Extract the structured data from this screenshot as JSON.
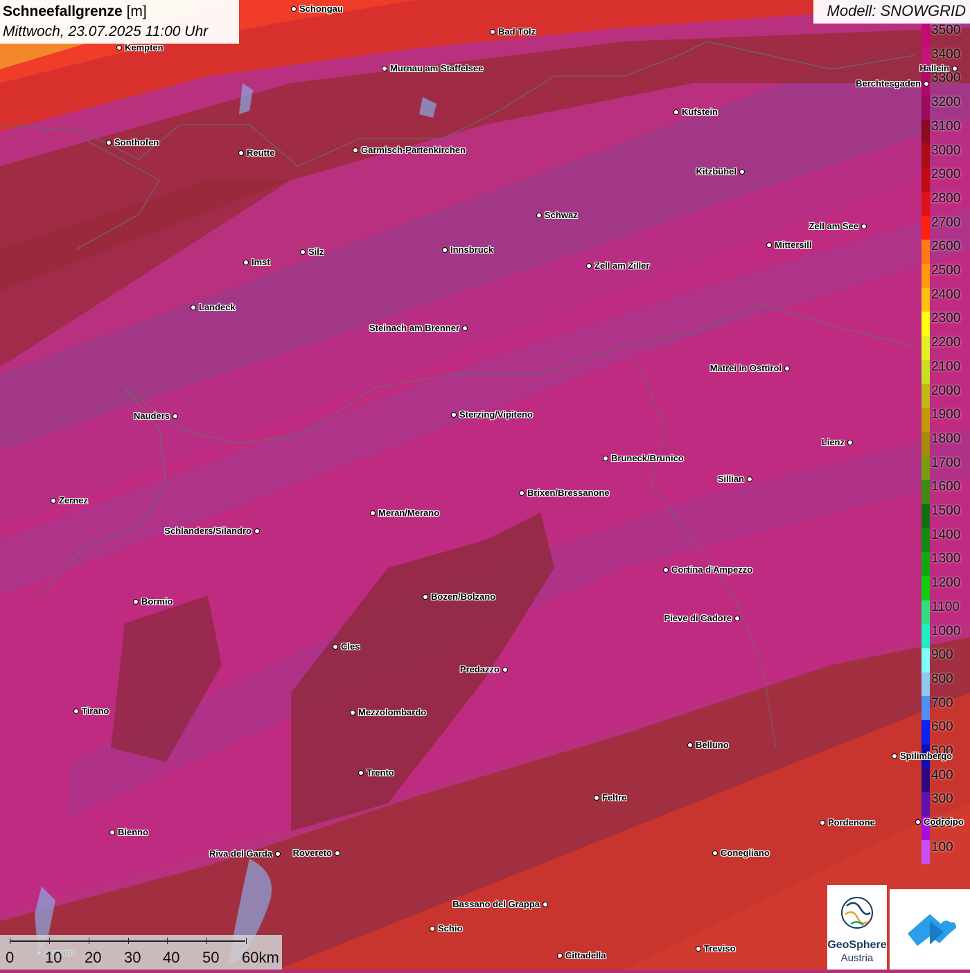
{
  "title": {
    "variable": "Schneefallgrenze",
    "unit": "[m]",
    "datetime": "Mittwoch, 23.07.2025 11:00 Uhr"
  },
  "model_label": "Modell: SNOWGRID",
  "legend": {
    "labels": [
      "3500",
      "3400",
      "3300",
      "3200",
      "3100",
      "3000",
      "2900",
      "2800",
      "2700",
      "2600",
      "2500",
      "2400",
      "2300",
      "2200",
      "2100",
      "2000",
      "1900",
      "1800",
      "1700",
      "1600",
      "1500",
      "1400",
      "1300",
      "1200",
      "1100",
      "1000",
      "900",
      "800",
      "700",
      "600",
      "500",
      "400",
      "300",
      "200",
      "100"
    ],
    "colors": [
      "#c40a74",
      "#c8127e",
      "#b0086e",
      "#9c0a5e",
      "#8a0a1e",
      "#a80c14",
      "#c00a10",
      "#e0101a",
      "#ff2010",
      "#ff7a14",
      "#ff9a10",
      "#ffc014",
      "#ffff10",
      "#e2f020",
      "#c8e020",
      "#c0b814",
      "#c09a08",
      "#a88c08",
      "#7a9c10",
      "#3c8c10",
      "#107010",
      "#108c10",
      "#10aa10",
      "#10cc10",
      "#30e080",
      "#20f0c0",
      "#80ffff",
      "#90c8f0",
      "#5090f0",
      "#1020f0",
      "#1010b0",
      "#2c0880",
      "#6010b0",
      "#a010e0",
      "#c850f0"
    ]
  },
  "cities": [
    {
      "name": "Schongau"
    },
    {
      "name": "Bad Tölz"
    },
    {
      "name": "Kempten"
    },
    {
      "name": "Murnau am Staffelsee"
    },
    {
      "name": "Hallein"
    },
    {
      "name": "Berchtesgaden"
    },
    {
      "name": "Kufstein"
    },
    {
      "name": "Sonthofen"
    },
    {
      "name": "Reutte"
    },
    {
      "name": "Garmisch-Partenkirchen"
    },
    {
      "name": "Kitzbühel"
    },
    {
      "name": "Schwaz"
    },
    {
      "name": "Zell am See"
    },
    {
      "name": "Mittersill"
    },
    {
      "name": "Innsbruck"
    },
    {
      "name": "Imst"
    },
    {
      "name": "Silz"
    },
    {
      "name": "Zell am Ziller"
    },
    {
      "name": "Landeck"
    },
    {
      "name": "Steinach am Brenner"
    },
    {
      "name": "Matrei in Osttirol"
    },
    {
      "name": "Nauders"
    },
    {
      "name": "Sterzing/Vipiteno"
    },
    {
      "name": "Lienz"
    },
    {
      "name": "Bruneck/Brunico"
    },
    {
      "name": "Sillian"
    },
    {
      "name": "Zernez"
    },
    {
      "name": "Brixen/Bressanone"
    },
    {
      "name": "Meran/Merano"
    },
    {
      "name": "Schlanders/Silandro"
    },
    {
      "name": "Cortina d'Ampezzo"
    },
    {
      "name": "Bormio"
    },
    {
      "name": "Bozen/Bolzano"
    },
    {
      "name": "Pieve di Cadore"
    },
    {
      "name": "Cles"
    },
    {
      "name": "Predazzo"
    },
    {
      "name": "Tirano"
    },
    {
      "name": "Mezzolombardo"
    },
    {
      "name": "Belluno"
    },
    {
      "name": "Spilimbergo"
    },
    {
      "name": "Trento"
    },
    {
      "name": "Feltre"
    },
    {
      "name": "Pordenone"
    },
    {
      "name": "Codroipo"
    },
    {
      "name": "Bienno"
    },
    {
      "name": "Riva del Garda"
    },
    {
      "name": "Rovereto"
    },
    {
      "name": "Conegliano"
    },
    {
      "name": "Bassano del Grappa"
    },
    {
      "name": "Schio"
    },
    {
      "name": "Lonato"
    },
    {
      "name": "Treviso"
    },
    {
      "name": "Cittadella"
    }
  ],
  "scale_bar": {
    "labels": [
      "0",
      "10",
      "20",
      "30",
      "40",
      "50",
      "60km"
    ]
  },
  "logo": {
    "line1": "GeoSphere",
    "line2": "Austria"
  }
}
